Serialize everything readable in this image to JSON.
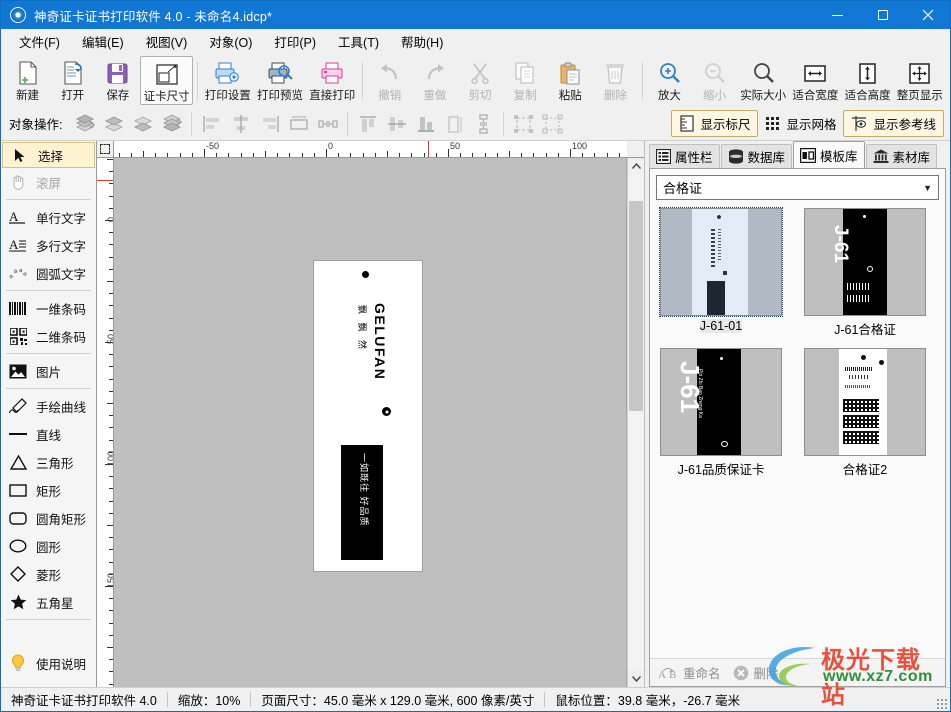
{
  "window": {
    "title": "神奇证卡证书打印软件 4.0 - 未命名4.idcp*",
    "app_icon": "app-circle-icon",
    "minimize": "–",
    "maximize": "□",
    "close": "✕",
    "titlebar_color": "#1177d4"
  },
  "menu": [
    {
      "label": "文件(F)"
    },
    {
      "label": "编辑(E)"
    },
    {
      "label": "视图(V)"
    },
    {
      "label": "对象(O)"
    },
    {
      "label": "打印(P)"
    },
    {
      "label": "工具(T)"
    },
    {
      "label": "帮助(H)"
    }
  ],
  "toolbar": [
    {
      "label": "新建",
      "icon": "new-document-icon",
      "state": "normal"
    },
    {
      "label": "打开",
      "icon": "open-folder-icon",
      "state": "normal"
    },
    {
      "label": "保存",
      "icon": "save-disk-icon",
      "state": "normal"
    },
    {
      "label": "证卡尺寸",
      "icon": "card-size-icon",
      "state": "active"
    },
    {
      "label": "打印设置",
      "icon": "print-settings-icon",
      "state": "normal"
    },
    {
      "label": "打印预览",
      "icon": "print-preview-icon",
      "state": "normal"
    },
    {
      "label": "直接打印",
      "icon": "print-icon",
      "state": "normal"
    },
    {
      "label": "撤销",
      "icon": "undo-arrow-icon",
      "state": "disabled"
    },
    {
      "label": "重做",
      "icon": "redo-arrow-icon",
      "state": "disabled"
    },
    {
      "label": "剪切",
      "icon": "scissors-icon",
      "state": "disabled"
    },
    {
      "label": "复制",
      "icon": "copy-icon",
      "state": "disabled"
    },
    {
      "label": "粘贴",
      "icon": "paste-icon",
      "state": "normal"
    },
    {
      "label": "删除",
      "icon": "trash-icon",
      "state": "disabled"
    },
    {
      "label": "放大",
      "icon": "zoom-in-icon",
      "state": "normal"
    },
    {
      "label": "缩小",
      "icon": "zoom-out-icon",
      "state": "disabled"
    },
    {
      "label": "实际大小",
      "icon": "actual-size-icon",
      "state": "normal"
    },
    {
      "label": "适合宽度",
      "icon": "fit-width-icon",
      "state": "normal"
    },
    {
      "label": "适合高度",
      "icon": "fit-height-icon",
      "state": "normal"
    },
    {
      "label": "整页显示",
      "icon": "fit-page-icon",
      "state": "normal"
    }
  ],
  "object_bar": {
    "label": "对象操作:",
    "buttons": [
      {
        "icon": "bring-to-front-icon"
      },
      {
        "icon": "bring-forward-icon"
      },
      {
        "icon": "send-backward-icon"
      },
      {
        "icon": "send-to-back-icon"
      },
      {
        "icon": "align-left-icon"
      },
      {
        "icon": "align-center-horizontal-icon"
      },
      {
        "icon": "align-right-icon"
      },
      {
        "icon": "same-width-icon"
      },
      {
        "icon": "distribute-horizontal-icon"
      },
      {
        "icon": "align-top-icon"
      },
      {
        "icon": "align-middle-vertical-icon"
      },
      {
        "icon": "align-bottom-icon"
      },
      {
        "icon": "same-height-icon"
      },
      {
        "icon": "distribute-vertical-icon"
      },
      {
        "icon": "group-icon"
      },
      {
        "icon": "ungroup-icon"
      }
    ],
    "toggles": [
      {
        "label": "显示标尺",
        "icon": "ruler-icon",
        "on": true
      },
      {
        "label": "显示网格",
        "icon": "grid-icon",
        "on": false
      },
      {
        "label": "显示参考线",
        "icon": "guideline-icon",
        "on": true
      }
    ]
  },
  "tools": [
    {
      "label": "选择",
      "icon": "cursor-arrow-icon",
      "state": "selected"
    },
    {
      "label": "滚屏",
      "icon": "hand-pan-icon",
      "state": "disabled"
    },
    {
      "label": "单行文字",
      "icon": "single-line-text-icon",
      "state": "normal"
    },
    {
      "label": "多行文字",
      "icon": "multi-line-text-icon",
      "state": "normal"
    },
    {
      "label": "圆弧文字",
      "icon": "arc-text-icon",
      "state": "normal"
    },
    {
      "label": "一维条码",
      "icon": "barcode-1d-icon",
      "state": "normal"
    },
    {
      "label": "二维条码",
      "icon": "qrcode-2d-icon",
      "state": "normal"
    },
    {
      "label": "图片",
      "icon": "image-icon",
      "state": "normal"
    },
    {
      "label": "手绘曲线",
      "icon": "pencil-curve-icon",
      "state": "normal"
    },
    {
      "label": "直线",
      "icon": "line-icon",
      "state": "normal"
    },
    {
      "label": "三角形",
      "icon": "triangle-icon",
      "state": "normal"
    },
    {
      "label": "矩形",
      "icon": "rectangle-icon",
      "state": "normal"
    },
    {
      "label": "圆角矩形",
      "icon": "rounded-rectangle-icon",
      "state": "normal"
    },
    {
      "label": "圆形",
      "icon": "ellipse-icon",
      "state": "normal"
    },
    {
      "label": "菱形",
      "icon": "diamond-icon",
      "state": "normal"
    },
    {
      "label": "五角星",
      "icon": "star-icon",
      "state": "normal"
    }
  ],
  "help_tool": {
    "label": "使用说明",
    "icon": "lightbulb-icon"
  },
  "rulers": {
    "horizontal_labels": [
      "-50",
      "0",
      "50",
      "100"
    ],
    "vertical_labels": [
      "0",
      "50",
      "100",
      "150"
    ],
    "guide_color": "#e03131"
  },
  "canvas": {
    "card": {
      "brand_text": "GELUFAN",
      "chinese_text": "飘 飘 然",
      "slogan": "一如既往 好品质"
    }
  },
  "right_panel": {
    "tabs": [
      {
        "label": "属性栏",
        "icon": "properties-list-icon",
        "active": false
      },
      {
        "label": "数据库",
        "icon": "database-icon",
        "active": false
      },
      {
        "label": "模板库",
        "icon": "template-library-icon",
        "active": true
      },
      {
        "label": "素材库",
        "icon": "material-bank-icon",
        "active": false
      }
    ],
    "category": "合格证",
    "templates": [
      {
        "name": "J-61-01",
        "selected": true,
        "style": "white-card"
      },
      {
        "name": "J-61合格证",
        "selected": false,
        "style": "black-j61"
      },
      {
        "name": "J-61品质保证卡",
        "selected": false,
        "style": "black-j61-big"
      },
      {
        "name": "合格证2",
        "selected": false,
        "style": "white-qrcode"
      }
    ],
    "footer": [
      {
        "label": "重命名",
        "icon": "rename-icon"
      },
      {
        "label": "删除",
        "icon": "delete-circle-icon"
      }
    ]
  },
  "status_bar": {
    "app": "神奇证卡证书打印软件 4.0",
    "zoom": "缩放：10%",
    "page_size": "页面尺寸：45.0 毫米 x 129.0 毫米, 600 像素/英寸",
    "mouse_position": "鼠标位置：39.8 毫米，-26.7 毫米"
  },
  "watermark": {
    "text": "极光下载站",
    "url": "www.xz7.com"
  }
}
